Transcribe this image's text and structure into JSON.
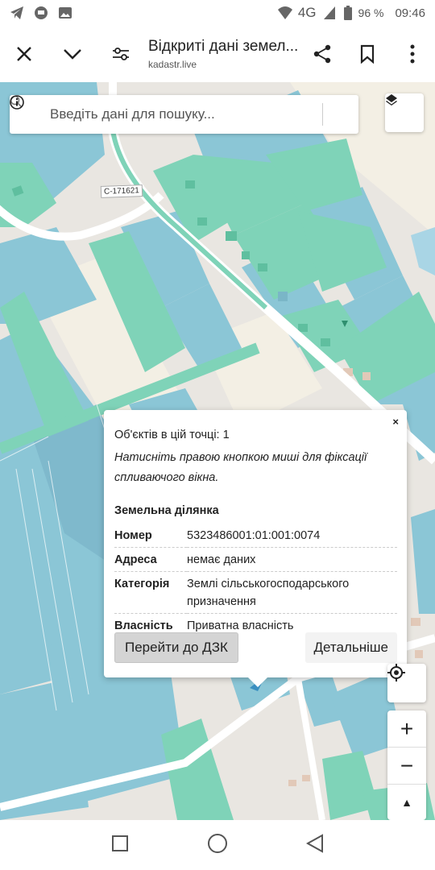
{
  "status_bar": {
    "network": "4G",
    "battery": "96 %",
    "time": "09:46",
    "left_icons": [
      "telegram-icon",
      "chat-icon",
      "gallery-icon"
    ],
    "right_icons": [
      "wifi-icon",
      "signal-icon",
      "battery-icon"
    ]
  },
  "toolbar": {
    "title": "Відкриті дані земел...",
    "url": "kadastr.live",
    "icons": [
      "close-icon",
      "chevron-down-icon",
      "tune-icon",
      "share-icon",
      "bookmark-icon",
      "more-icon"
    ]
  },
  "search": {
    "placeholder": "Введіть дані для пошуку..."
  },
  "map": {
    "road_label": "C-171621",
    "colors": {
      "parcel_blue": "#8bc6d6",
      "parcel_green": "#7fd3b8",
      "road": "#ffffff",
      "background": "#e9e6e1"
    }
  },
  "popup": {
    "close": "×",
    "count_text": "Об'єктів в цій точці: 1",
    "hint": "Натисніть правою кнопкою миші для фіксації спливаючого вікна.",
    "section_title": "Земельна ділянка",
    "rows": [
      {
        "key": "Номер",
        "value": "5323486001:01:001:0074"
      },
      {
        "key": "Адреса",
        "value": "немає даних"
      },
      {
        "key": "Категорія",
        "value": "Землі сільськогосподарського призначення"
      },
      {
        "key": "Власність",
        "value": "Приватна власність"
      }
    ],
    "primary_button": "Перейти до ДЗК",
    "secondary_button": "Детальніше"
  },
  "controls": {
    "zoom_in": "+",
    "zoom_out": "−",
    "compass": "▲"
  }
}
